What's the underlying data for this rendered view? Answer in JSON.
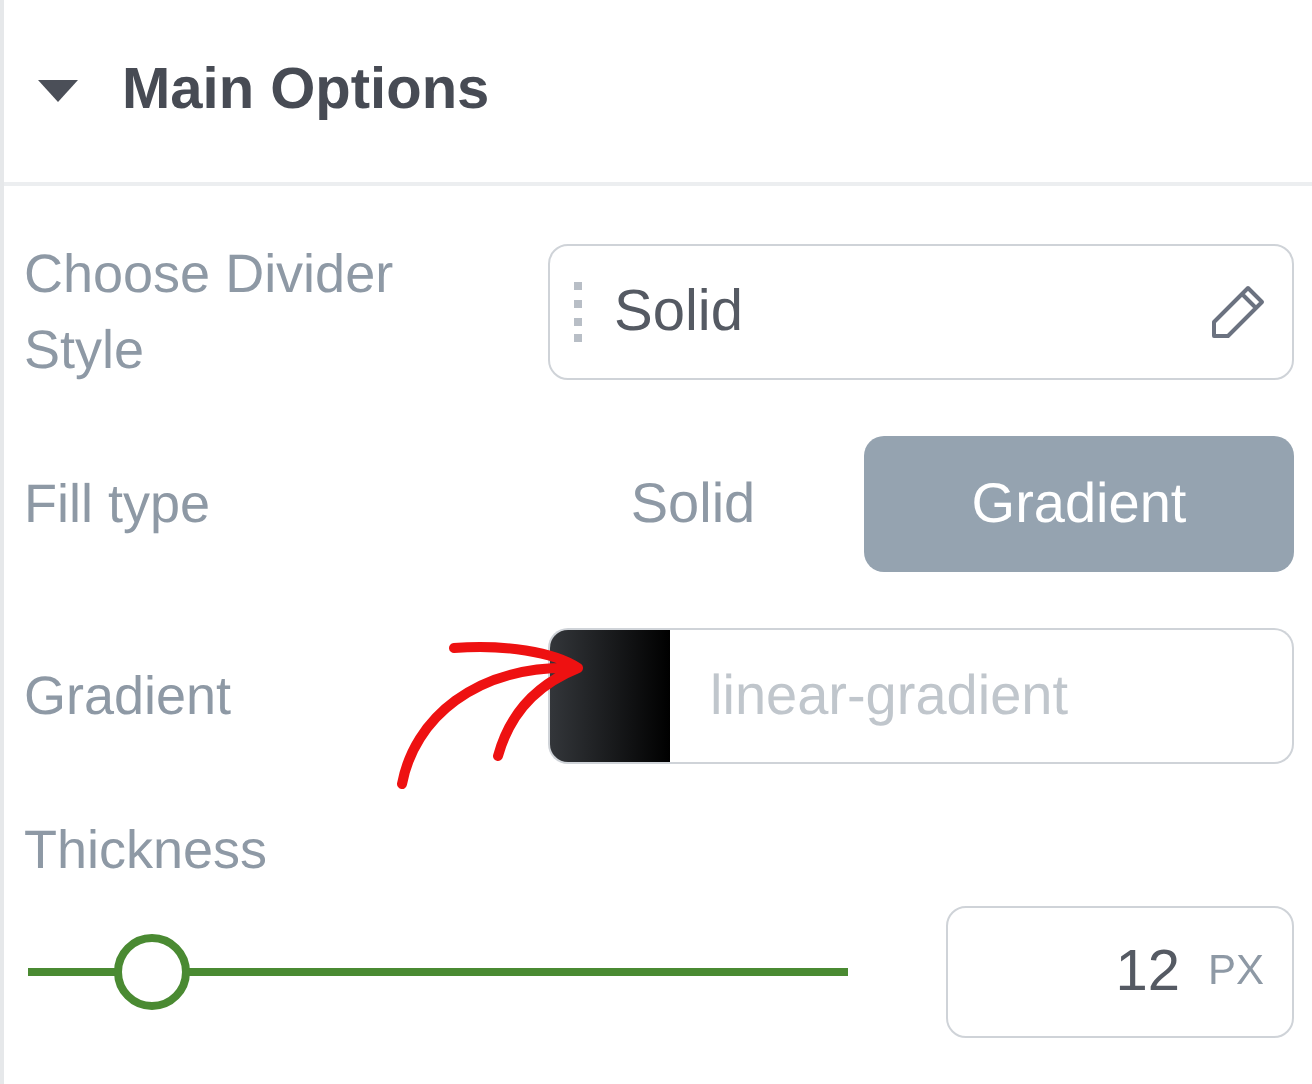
{
  "section": {
    "title": "Main Options",
    "expanded": true
  },
  "divider_style": {
    "label": "Choose Divider Style",
    "value": "Solid"
  },
  "fill_type": {
    "label": "Fill type",
    "options": [
      {
        "label": "Solid",
        "selected": false
      },
      {
        "label": "Gradient",
        "selected": true
      }
    ]
  },
  "gradient": {
    "label": "Gradient",
    "placeholder": "linear-gradient"
  },
  "thickness": {
    "label": "Thickness",
    "level": 0.15,
    "value": "12",
    "unit": "PX"
  }
}
